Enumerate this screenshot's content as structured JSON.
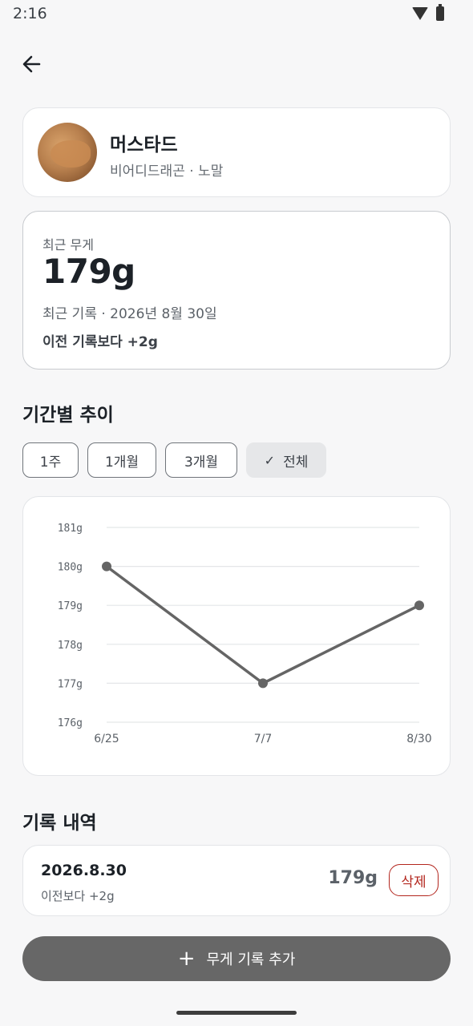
{
  "status": {
    "time": "2:16",
    "icons": [
      "wifi-icon",
      "battery-icon"
    ]
  },
  "nav": {
    "back_icon": "arrow-left-icon"
  },
  "profile": {
    "name": "머스타드",
    "subtitle": "비어디드래곤 · 노말"
  },
  "weight": {
    "label": "최근 무게",
    "value": "179g",
    "recent_record": "최근 기록 · 2026년 8월 30일",
    "diff": "이전 기록보다 +2g"
  },
  "trend": {
    "title": "기간별 추이",
    "chips": [
      {
        "label": "1주",
        "selected": false
      },
      {
        "label": "1개월",
        "selected": false
      },
      {
        "label": "3개월",
        "selected": false
      },
      {
        "label": "전체",
        "selected": true
      }
    ]
  },
  "chart_data": {
    "type": "line",
    "x": [
      "6/25",
      "7/7",
      "8/30"
    ],
    "series": [
      {
        "values": [
          180,
          177,
          179
        ]
      }
    ],
    "yticks": [
      "181g",
      "180g",
      "179g",
      "178g",
      "177g",
      "176g"
    ],
    "ylim": [
      176,
      181
    ],
    "grid": true,
    "color": "#656565"
  },
  "history": {
    "title": "기록 내역",
    "records": [
      {
        "date": "2026.8.30",
        "diff": "이전보다 +2g",
        "weight": "179g",
        "delete_label": "삭제"
      }
    ]
  },
  "add_button": {
    "label": "무게 기록 추가",
    "icon": "plus-icon"
  },
  "colors": {
    "accent": "#676767",
    "danger": "#b3261e",
    "background": "#f7f7f8"
  }
}
